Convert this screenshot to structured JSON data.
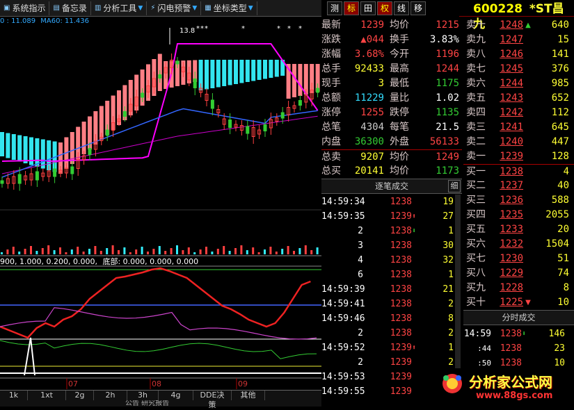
{
  "menu": [
    "系统指示",
    "备忘录",
    "分析工具",
    "闪电预警",
    "坐标类型"
  ],
  "right_buttons": [
    "测",
    "标",
    "田",
    "权",
    "线",
    "移"
  ],
  "code": "600228",
  "name": "*ST昌九",
  "info_line": {
    "ma_prefix": "0 : 11.089",
    "ma60": "MA60: 11.436"
  },
  "price_label": "13.8",
  "indicator_line": {
    "a": "900, 1.000, 0.200, 0.000,",
    "b": "底部: 0.000, 0.000, 0.000"
  },
  "months": [
    "07",
    "08",
    "09"
  ],
  "bottom_tabs": [
    "1k",
    "1xt",
    "2g",
    "2h",
    "3h",
    "4g",
    "DDE决策",
    "其他"
  ],
  "bottom_note": "公告 研究报告",
  "quote": [
    {
      "l": "最新",
      "v": "1239",
      "vc": "red",
      "l2": "均价",
      "v2": "1215",
      "v2c": "red"
    },
    {
      "l": "涨跌",
      "v": "▲044",
      "vc": "red",
      "l2": "换手",
      "v2": "3.83%",
      "v2c": "white"
    },
    {
      "l": "涨幅",
      "v": "3.68%",
      "vc": "red",
      "l2": "今开",
      "v2": "1196",
      "v2c": "red"
    },
    {
      "l": "总手",
      "v": "92433",
      "vc": "yellow",
      "l2": "最高",
      "v2": "1244",
      "v2c": "red"
    },
    {
      "l": "现手",
      "v": "3",
      "vc": "yellow",
      "l2": "最低",
      "v2": "1175",
      "v2c": "green"
    },
    {
      "l": "总额",
      "v": "11229",
      "vc": "cyan",
      "l2": "量比",
      "v2": "1.02",
      "v2c": "white"
    },
    {
      "l": "涨停",
      "v": "1255",
      "vc": "red",
      "l2": "跌停",
      "v2": "1135",
      "v2c": "green"
    },
    {
      "l": "总笔",
      "v": "4304",
      "vc": "gray",
      "l2": "每笔",
      "v2": "21.5",
      "v2c": "white"
    },
    {
      "l": "内盘",
      "v": "36300",
      "vc": "green",
      "l2": "外盘",
      "v2": "56133",
      "v2c": "red"
    },
    {
      "l": "总卖",
      "v": "9207",
      "vc": "yellow",
      "l2": "均价",
      "v2": "1249",
      "v2c": "red"
    },
    {
      "l": "总买",
      "v": "20141",
      "vc": "yellow",
      "l2": "均价",
      "v2": "1173",
      "v2c": "green"
    }
  ],
  "book": [
    {
      "l": "卖十",
      "p": "1248",
      "m": "▲",
      "v": "640"
    },
    {
      "l": "卖九",
      "p": "1247",
      "m": "",
      "v": "15"
    },
    {
      "l": "卖八",
      "p": "1246",
      "m": "",
      "v": "141"
    },
    {
      "l": "卖七",
      "p": "1245",
      "m": "",
      "v": "376"
    },
    {
      "l": "卖六",
      "p": "1244",
      "m": "",
      "v": "985"
    },
    {
      "l": "卖五",
      "p": "1243",
      "m": "",
      "v": "652"
    },
    {
      "l": "卖四",
      "p": "1242",
      "m": "",
      "v": "112"
    },
    {
      "l": "卖三",
      "p": "1241",
      "m": "",
      "v": "645"
    },
    {
      "l": "卖二",
      "p": "1240",
      "m": "",
      "v": "447"
    },
    {
      "l": "卖一",
      "p": "1239",
      "m": "",
      "v": "128"
    },
    {
      "l": "买一",
      "p": "1238",
      "m": "",
      "v": "4"
    },
    {
      "l": "买二",
      "p": "1237",
      "m": "",
      "v": "40"
    },
    {
      "l": "买三",
      "p": "1236",
      "m": "",
      "v": "588"
    },
    {
      "l": "买四",
      "p": "1235",
      "m": "",
      "v": "2055"
    },
    {
      "l": "买五",
      "p": "1233",
      "m": "",
      "v": "20"
    },
    {
      "l": "买六",
      "p": "1232",
      "m": "",
      "v": "1504"
    },
    {
      "l": "买七",
      "p": "1230",
      "m": "",
      "v": "51"
    },
    {
      "l": "买八",
      "p": "1229",
      "m": "",
      "v": "74"
    },
    {
      "l": "买九",
      "p": "1228",
      "m": "",
      "v": "8"
    },
    {
      "l": "买十",
      "p": "1225",
      "m": "▼",
      "v": "10"
    }
  ],
  "trade_header": "逐笔成交",
  "trade_tag": "细",
  "trades": [
    {
      "t": "14:59:34",
      "p": "1238",
      "a": "",
      "v": "19"
    },
    {
      "t": "14:59:35",
      "p": "1239",
      "a": "up",
      "v": "27"
    },
    {
      "t": "2",
      "p": "1238",
      "a": "down",
      "v": "1"
    },
    {
      "t": "3",
      "p": "1238",
      "a": "",
      "v": "30"
    },
    {
      "t": "4",
      "p": "1238",
      "a": "",
      "v": "32"
    },
    {
      "t": "6",
      "p": "1238",
      "a": "",
      "v": "1"
    },
    {
      "t": "14:59:39",
      "p": "1238",
      "a": "",
      "v": "21"
    },
    {
      "t": "14:59:41",
      "p": "1238",
      "a": "",
      "v": "2"
    },
    {
      "t": "14:59:46",
      "p": "1238",
      "a": "",
      "v": "8"
    },
    {
      "t": "2",
      "p": "1238",
      "a": "",
      "v": "2"
    },
    {
      "t": "14:59:52",
      "p": "1239",
      "a": "up",
      "v": "1"
    },
    {
      "t": "2",
      "p": "1239",
      "a": "",
      "v": "2"
    },
    {
      "t": "14:59:53",
      "p": "1239",
      "a": "",
      "v": "1"
    },
    {
      "t": "14:59:55",
      "p": "1239",
      "a": "",
      "v": ""
    }
  ],
  "time_header": "分时成交",
  "timesales": [
    {
      "t": "14:59",
      "p": "1238",
      "a": "down",
      "v": "146"
    },
    {
      "t": ":44",
      "p": "1238",
      "a": "",
      "v": "23"
    },
    {
      "t": ":50",
      "p": "1238",
      "a": "",
      "v": "10"
    }
  ],
  "logo": {
    "title": "分析家公式网",
    "url": "www.88gs.com"
  },
  "colors": {
    "up": "#ff4040",
    "down": "#33cc33",
    "cloud_up": "#ff7f85",
    "cloud_down": "#33e5ef",
    "ma_magenta": "#ff00ff"
  }
}
